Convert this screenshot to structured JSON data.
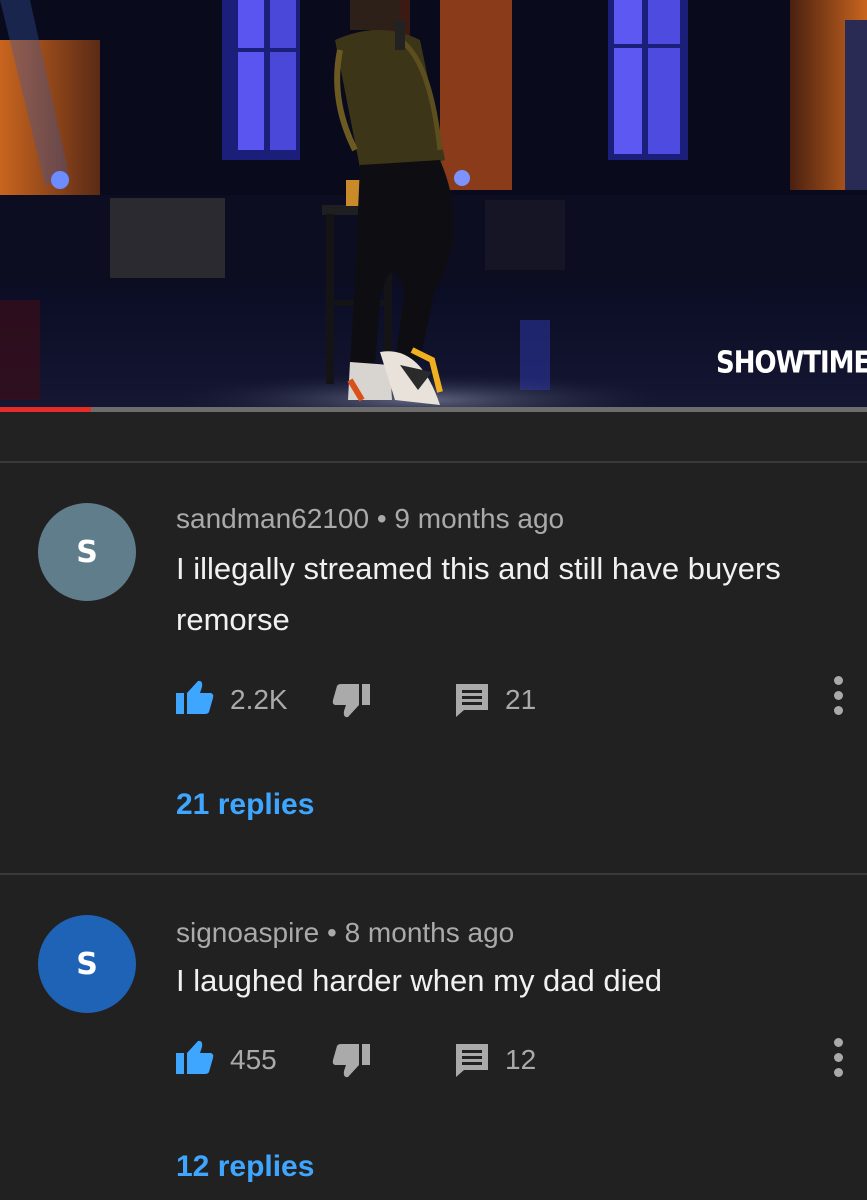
{
  "video": {
    "watermark": "SHOWTIME",
    "progress": 0.105
  },
  "comments": [
    {
      "avatar_letter": "S",
      "avatar_color": "#607d8b",
      "author": "sandman62100",
      "separator": "•",
      "time": "9 months ago",
      "text": "I illegally streamed this and still have buyers remorse",
      "likes": "2.2K",
      "reply_count": "21",
      "replies_label": "21 replies"
    },
    {
      "avatar_letter": "S",
      "avatar_color": "#1e63b6",
      "author": "signoaspire",
      "separator": "•",
      "time": "8 months ago",
      "text": "I laughed harder when my dad died",
      "likes": "455",
      "reply_count": "12",
      "replies_label": "12 replies"
    }
  ],
  "icons": {
    "like": "thumbs-up-icon",
    "dislike": "thumbs-down-icon",
    "reply": "comment-icon",
    "more": "more-vertical-icon"
  },
  "colors": {
    "background": "#212121",
    "like_active": "#3ea6ff",
    "replies_link": "#3ea6ff",
    "progress": "#e52d27"
  }
}
